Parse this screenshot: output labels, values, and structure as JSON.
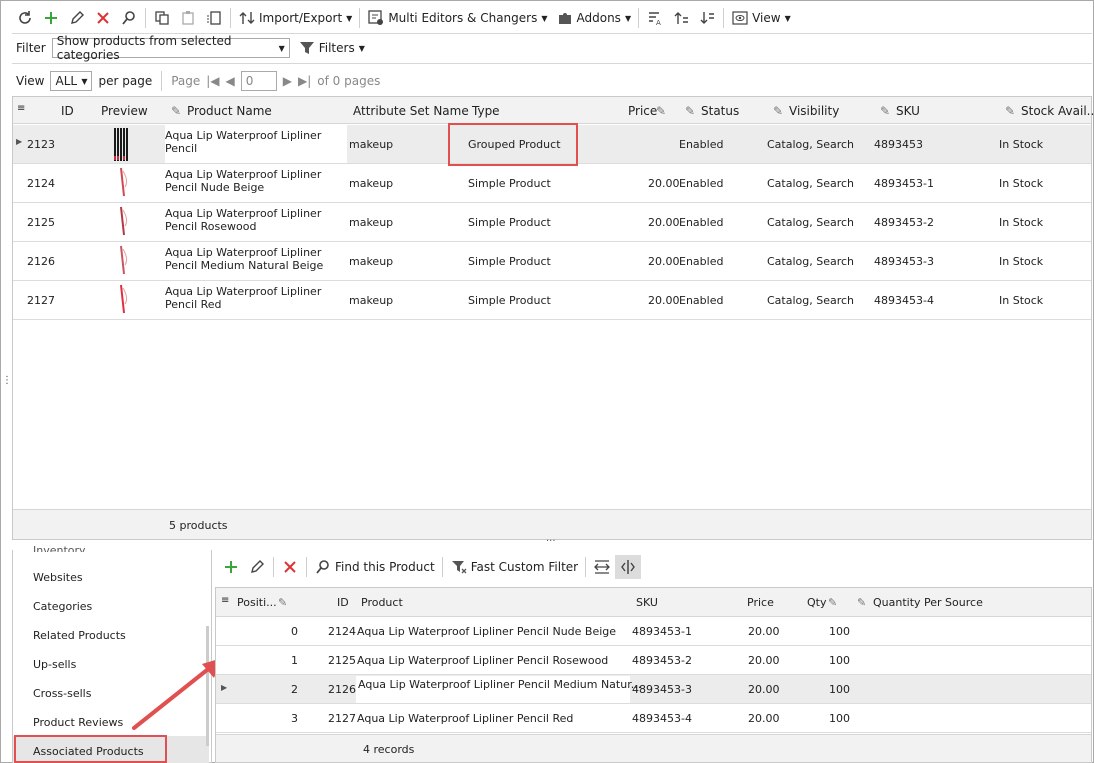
{
  "toolbar": {
    "import_export": "Import/Export",
    "multi_editors": "Multi Editors & Changers",
    "addons": "Addons",
    "view": "View"
  },
  "filter": {
    "label": "Filter",
    "value": "Show products from selected categories",
    "filters_btn": "Filters"
  },
  "pager": {
    "view_label": "View",
    "view_value": "ALL",
    "per_page": "per page",
    "page_label": "Page",
    "page_value": "0",
    "of_pages": "of 0 pages"
  },
  "grid": {
    "columns": [
      "ID",
      "Preview",
      "Product Name",
      "Attribute Set Name",
      "Type",
      "Price",
      "Status",
      "Visibility",
      "SKU",
      "Stock Avail..."
    ],
    "rows": [
      {
        "id": "2123",
        "name1": "Aqua Lip Waterproof Lipliner",
        "name2": "Pencil",
        "attr": "makeup",
        "type": "Grouped Product",
        "price": "",
        "status": "Enabled",
        "vis": "Catalog, Search",
        "sku": "4893453",
        "stock": "In Stock"
      },
      {
        "id": "2124",
        "name1": "Aqua Lip Waterproof Lipliner",
        "name2": "Pencil Nude Beige",
        "attr": "makeup",
        "type": "Simple Product",
        "price": "20.00",
        "status": "Enabled",
        "vis": "Catalog, Search",
        "sku": "4893453-1",
        "stock": "In Stock"
      },
      {
        "id": "2125",
        "name1": "Aqua Lip Waterproof Lipliner",
        "name2": "Pencil Rosewood",
        "attr": "makeup",
        "type": "Simple Product",
        "price": "20.00",
        "status": "Enabled",
        "vis": "Catalog, Search",
        "sku": "4893453-2",
        "stock": "In Stock"
      },
      {
        "id": "2126",
        "name1": "Aqua Lip Waterproof Lipliner",
        "name2": "Pencil Medium Natural Beige",
        "attr": "makeup",
        "type": "Simple Product",
        "price": "20.00",
        "status": "Enabled",
        "vis": "Catalog, Search",
        "sku": "4893453-3",
        "stock": "In Stock"
      },
      {
        "id": "2127",
        "name1": "Aqua Lip Waterproof Lipliner",
        "name2": "Pencil Red",
        "attr": "makeup",
        "type": "Simple Product",
        "price": "20.00",
        "status": "Enabled",
        "vis": "Catalog, Search",
        "sku": "4893453-4",
        "stock": "In Stock"
      }
    ],
    "footer": "5 products"
  },
  "left_list": {
    "partial": "Inventory",
    "items": [
      "Websites",
      "Categories",
      "Related Products",
      "Up-sells",
      "Cross-sells",
      "Product Reviews",
      "Associated Products"
    ]
  },
  "sub_toolbar": {
    "find": "Find this Product",
    "fast_filter": "Fast Custom Filter"
  },
  "sub_grid": {
    "columns": [
      "Positi...",
      "ID",
      "Product",
      "SKU",
      "Price",
      "Qty",
      "Quantity Per Source"
    ],
    "rows": [
      {
        "pos": "0",
        "id": "2124",
        "product": "Aqua Lip Waterproof Lipliner Pencil Nude Beige",
        "sku": "4893453-1",
        "price": "20.00",
        "qty": "100"
      },
      {
        "pos": "1",
        "id": "2125",
        "product": "Aqua Lip Waterproof Lipliner Pencil Rosewood",
        "sku": "4893453-2",
        "price": "20.00",
        "qty": "100"
      },
      {
        "pos": "2",
        "id": "2126",
        "product": "Aqua Lip Waterproof Lipliner Pencil Medium Natur...",
        "sku": "4893453-3",
        "price": "20.00",
        "qty": "100"
      },
      {
        "pos": "3",
        "id": "2127",
        "product": "Aqua Lip Waterproof Lipliner Pencil Red",
        "sku": "4893453-4",
        "price": "20.00",
        "qty": "100"
      }
    ],
    "footer": "4 records"
  },
  "colors": {
    "highlight": "#e05050",
    "add": "#3aa63a",
    "delete": "#d33"
  }
}
